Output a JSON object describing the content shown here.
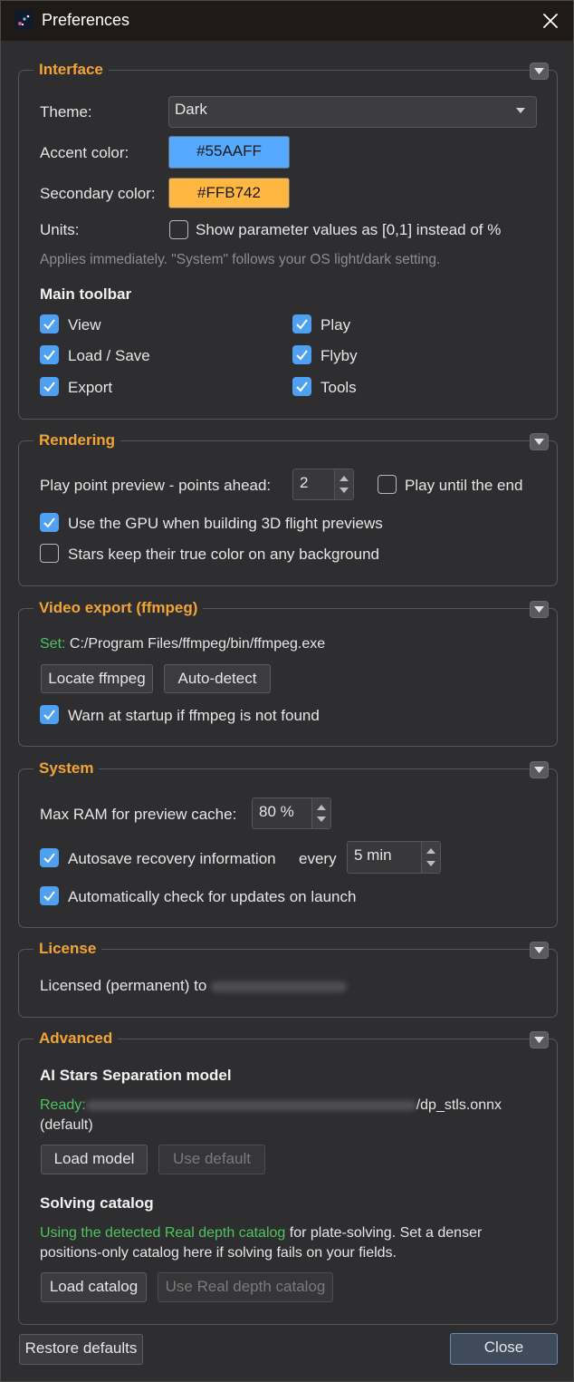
{
  "window": {
    "title": "Preferences"
  },
  "interface": {
    "title": "Interface",
    "theme_label": "Theme:",
    "theme_value": "Dark",
    "accent_label": "Accent color:",
    "accent_value": "#55AAFF",
    "secondary_label": "Secondary color:",
    "secondary_value": "#FFB742",
    "units_label": "Units:",
    "units_checkbox": "Show parameter values as [0,1] instead of %",
    "units_checked": false,
    "hint": "Applies immediately. \"System\" follows your OS light/dark setting.",
    "toolbar_heading": "Main toolbar",
    "toolbar_items": [
      {
        "label": "View",
        "checked": true
      },
      {
        "label": "Load / Save",
        "checked": true
      },
      {
        "label": "Export",
        "checked": true
      },
      {
        "label": "Play",
        "checked": true
      },
      {
        "label": "Flyby",
        "checked": true
      },
      {
        "label": "Tools",
        "checked": true
      }
    ]
  },
  "rendering": {
    "title": "Rendering",
    "points_label": "Play point preview - points ahead:",
    "points_value": "2",
    "play_until_end": "Play until the end",
    "play_until_end_checked": false,
    "gpu_label": "Use the GPU when building 3D flight previews",
    "gpu_checked": true,
    "stars_label": "Stars keep their true color on any background",
    "stars_checked": false
  },
  "video": {
    "title": "Video export (ffmpeg)",
    "set_prefix": "Set:",
    "path": "C:/Program Files/ffmpeg/bin/ffmpeg.exe",
    "locate_button": "Locate ffmpeg",
    "autodetect_button": "Auto-detect",
    "warn_label": "Warn at startup if ffmpeg is not found",
    "warn_checked": true
  },
  "system": {
    "title": "System",
    "ram_label": "Max RAM for preview cache:",
    "ram_value": "80 %",
    "autosave_label": "Autosave recovery information",
    "autosave_checked": true,
    "every_label": "every",
    "every_value": "5 min",
    "updates_label": "Automatically check for updates on launch",
    "updates_checked": true
  },
  "license": {
    "title": "License",
    "text": "Licensed (permanent) to"
  },
  "advanced": {
    "title": "Advanced",
    "model_heading": "AI Stars Separation model",
    "ready_prefix": "Ready:",
    "model_file": "/dp_stls.onnx",
    "model_default": "(default)",
    "load_model_button": "Load model",
    "use_default_button": "Use default",
    "catalog_heading": "Solving catalog",
    "catalog_green": "Using the detected Real depth catalog",
    "catalog_text_1": " for plate-solving. Set a denser",
    "catalog_text_2": "positions-only catalog here if solving fails on your fields.",
    "load_catalog_button": "Load catalog",
    "use_real_depth_button": "Use Real depth catalog"
  },
  "footer": {
    "restore_button": "Restore defaults",
    "close_button": "Close"
  },
  "colors": {
    "accent": "#55AAFF",
    "secondary": "#FFB742",
    "group_title": "#F2A435",
    "ready_green": "#4EC35F"
  }
}
